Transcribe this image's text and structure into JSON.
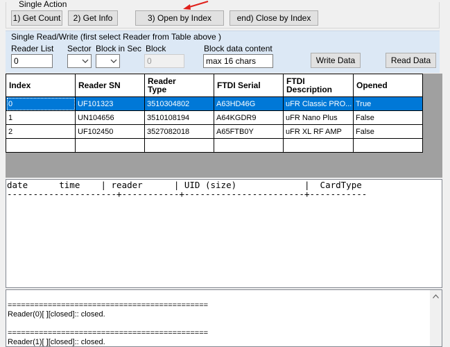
{
  "single_action": {
    "title": "Single Action",
    "buttons": {
      "get_count": "1) Get Count",
      "get_info": "2) Get Info",
      "open_by_index": "3) Open by Index",
      "close_by_index": "end) Close by Index"
    }
  },
  "read_write": {
    "title": "Single Read/Write  (first select Reader from Table above )",
    "reader_list_label": "Reader List",
    "reader_list_value": "0",
    "sector_label": "Sector",
    "block_in_sec_label": "Block in Sec",
    "block_label": "Block",
    "block_value": "0",
    "block_data_label": "Block data content",
    "block_data_value": "max 16 chars",
    "write_button": "Write Data",
    "read_button": "Read Data"
  },
  "table": {
    "headers": [
      "Index",
      "Reader SN",
      "Reader\nType",
      "FTDI Serial",
      "FTDI\nDescription",
      "Opened"
    ],
    "rows": [
      [
        "0",
        "UF101323",
        "3510304802",
        "A63HD46G",
        "uFR Classic PRO...",
        "True"
      ],
      [
        "1",
        "UN104656",
        "3510108194",
        "A64KGDR9",
        "uFR Nano Plus",
        "False"
      ],
      [
        "2",
        "UF102450",
        "3527082018",
        "A65FTB0Y",
        "uFR XL RF AMP",
        "False"
      ]
    ],
    "selected_row": 0
  },
  "log": {
    "header": "date      time    | reader      | UID (size)             |  CardType",
    "separator": "---------------------+-----------+-----------------------+-----------"
  },
  "messages": {
    "lines": [
      "=============================================",
      "Reader(0)[ ][closed]:: closed.",
      "=============================================",
      "Reader(1)[ ][closed]:: closed."
    ]
  },
  "colors": {
    "selection": "#0078d7",
    "panel": "#dce8f5",
    "arrow": "#e0201b"
  }
}
